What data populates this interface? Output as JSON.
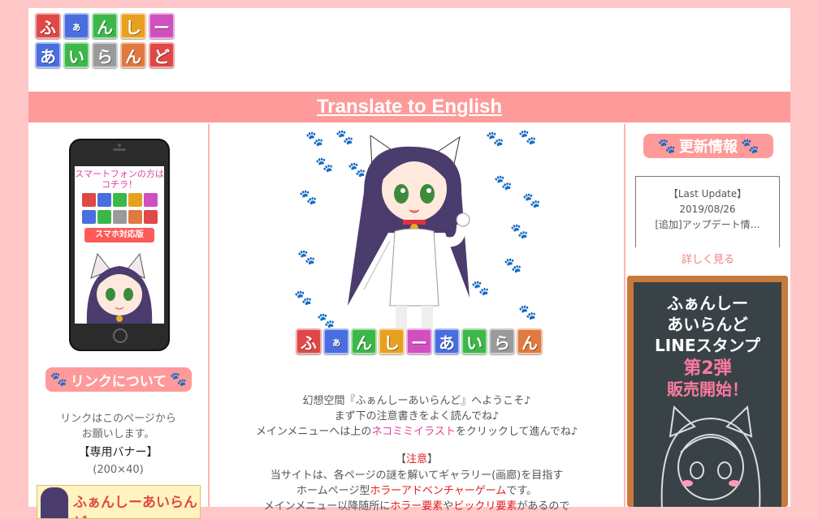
{
  "site": {
    "logo": {
      "row1": [
        "ふ",
        "ぁ",
        "ん",
        "し",
        "ー"
      ],
      "row2": [
        "あ",
        "い",
        "ら",
        "ん",
        "ど"
      ],
      "colors": [
        "#e04848",
        "#4a6ee0",
        "#3cb84a",
        "#e8a020",
        "#d050c0"
      ]
    },
    "translate_link": "Translate to English"
  },
  "left": {
    "phone": {
      "caption": "スマートフォンの方はコチラ！",
      "badge": "スマホ対応版"
    },
    "link_heading": "リンクについて",
    "link_text_1": "リンクはこのページから",
    "link_text_2": "お願いします。",
    "banner_label": "【専用バナー】",
    "banner_size": "(200×40)",
    "banner_title": "ふぁんしーあいらんど"
  },
  "main": {
    "intro_1": "幻想空間『ふぁんしーあいらんど』へようこそ♪",
    "intro_2": "まず下の注意書きをよく読んでね♪",
    "intro_3_a": "メインメニューへは上の",
    "intro_3_link": "ネコミミイラスト",
    "intro_3_b": "をクリックして進んでね♪",
    "notice_open": "【",
    "notice_word": "注意",
    "notice_close": "】",
    "notice_1": "当サイトは、各ページの謎を解いてギャラリー(画廊)を目指す",
    "notice_2_a": "ホームページ型",
    "notice_2_link": "ホラーアドベンチャーゲーム",
    "notice_2_b": "です。",
    "notice_3_a": "メインメニュー以降随所に",
    "notice_3_r1": "ホラー要素",
    "notice_3_mid": "や",
    "notice_3_r2": "ビックリ要素",
    "notice_3_b": "があるので"
  },
  "right": {
    "heading": "更新情報",
    "update_label": "【Last Update】",
    "update_date": "2019/08/26",
    "update_text": "[追加]アップデート情…",
    "more_link": "詳しく見る",
    "board_1": "ふぁんしー",
    "board_2": "あいらんど",
    "board_3": "LINEスタンプ",
    "board_4": "第2弾",
    "board_5": "販売開始！"
  }
}
